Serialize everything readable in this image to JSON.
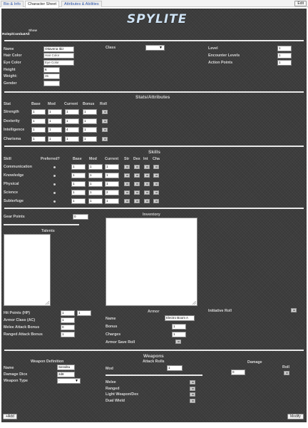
{
  "tabs": [
    {
      "label": "Bio & Info",
      "active": false
    },
    {
      "label": "Character Sheet",
      "active": true
    },
    {
      "label": "Attributes & Abilities",
      "active": false
    }
  ],
  "edit_label": "Edit",
  "title": "SPYLITE",
  "roll_buttons": {
    "top": "Show",
    "left": "RoleplCombatAll"
  },
  "identity": {
    "name_label": "Name",
    "name_value": "Ottavena Ibiz",
    "hair_label": "Hair Color",
    "hair_value": "Hair Color",
    "eye_label": "Eye Color",
    "eye_value": "Eye Color",
    "height_label": "Height",
    "height_value": "6",
    "weight_label": "Weight:",
    "weight_value": "35",
    "gender_label": "Gender",
    "gender_value": "",
    "class_label": "Class",
    "class_value": "",
    "level_label": "Level",
    "level_value": "1",
    "encounter_label": "Encounter Levels",
    "encounter_value": "1",
    "action_label": "Action Points",
    "action_value": "1"
  },
  "stats": {
    "title": "Stats/Attributes",
    "headers": [
      "Stat",
      "Base",
      "Mod",
      "Current",
      "Bonus",
      "Roll"
    ],
    "rows": [
      {
        "name": "Strength",
        "base": "1",
        "mod": "1",
        "current": "1",
        "bonus": "1"
      },
      {
        "name": "Dexterity",
        "base": "1",
        "mod": "1",
        "current": "1",
        "bonus": "1"
      },
      {
        "name": "Intelligence",
        "base": "1",
        "mod": "1",
        "current": "4",
        "bonus": "1"
      },
      {
        "name": "Charisma",
        "base": "1",
        "mod": "1",
        "current": "1",
        "bonus": "1"
      }
    ]
  },
  "skills": {
    "title": "Skills",
    "headers": [
      "Skill",
      "Preferred?",
      "Base",
      "Mod",
      "Current",
      "Str",
      "Dex",
      "Int",
      "Cha"
    ],
    "rows": [
      {
        "name": "Communication",
        "base": "1",
        "mod": "1",
        "current": "1"
      },
      {
        "name": "Knowledge",
        "base": "1",
        "mod": "1",
        "current": "1"
      },
      {
        "name": "Physical",
        "base": "1",
        "mod": "1",
        "current": "1"
      },
      {
        "name": "Science",
        "base": "1",
        "mod": "1",
        "current": "2"
      },
      {
        "name": "Subterfuge",
        "base": "1",
        "mod": "1",
        "current": "1"
      }
    ]
  },
  "gear": {
    "label": "Gear Points",
    "value": "0"
  },
  "talents_title": "Talents",
  "inventory_title": "Inventory",
  "health": {
    "hp_label": "Hit Points (HP)",
    "hp_value": "1",
    "hp_max": "1",
    "ac_label": "Armor Class (AC)",
    "ac_value": "1",
    "melee_label": "Melee Attack Bonus",
    "melee_value": "0",
    "ranged_label": "Ranged Attack Bonus",
    "ranged_value": "1"
  },
  "armor": {
    "title": "Armor",
    "name_label": "Name",
    "name_value": "Electro Boom A",
    "bonus_label": "Bonus",
    "bonus_value": "1",
    "charges_label": "Charges",
    "charges_value": "1",
    "save_label": "Armor Save Roll"
  },
  "initiative_label": "Initiative Roll",
  "weapons": {
    "title": "Weapons",
    "definition_title": "Weapon Definition",
    "name_label": "Name",
    "name_value": "Sensilta",
    "dice_label": "Damage Dice",
    "dice_value": "2d8",
    "type_label": "Weapon Type",
    "type_value": "-",
    "attack_title": "Attack Rolls",
    "mod_label": "Mod",
    "mod_value": "1",
    "damage_title": "Damage",
    "damage_mod_value": "0",
    "damage_roll_label": "Roll",
    "rolls": [
      "Melee",
      "Ranged",
      "Light Weapon/Dex",
      "Dual Wield"
    ]
  },
  "footer": {
    "add_label": "+Add",
    "modify_label": "Modify"
  },
  "colors": {
    "background": "#3d3d3d",
    "title": "#cfe3f5",
    "tab_link": "#2a52a8"
  }
}
